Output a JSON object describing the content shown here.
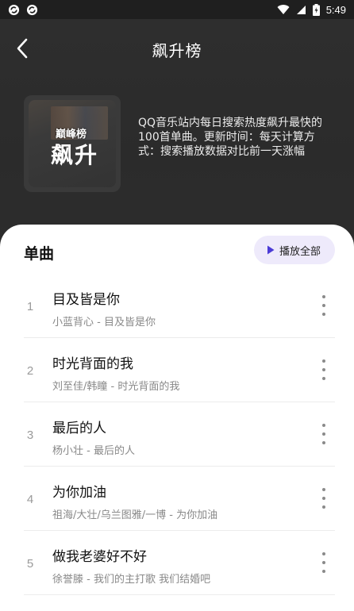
{
  "status_bar": {
    "time": "5:49",
    "left_icons": [
      "sync-icon",
      "sync-icon"
    ],
    "right_icons": [
      "wifi-icon",
      "signal-icon",
      "battery-icon"
    ]
  },
  "header": {
    "title": "飙升榜",
    "back_icon": "chevron-left-icon"
  },
  "cover": {
    "brand": "巅峰榜",
    "title": "飙升"
  },
  "description": "QQ音乐站内每日搜索热度飙升最快的100首单曲。更新时间：每天计算方式：搜索播放数据对比前一天涨幅",
  "section": {
    "title": "单曲",
    "play_all_label": "播放全部",
    "play_icon": "play-icon"
  },
  "songs": [
    {
      "index": "1",
      "title": "目及皆是你",
      "subtitle": "小蓝背心 - 目及皆是你"
    },
    {
      "index": "2",
      "title": "时光背面的我",
      "subtitle": "刘至佳/韩瞳 - 时光背面的我"
    },
    {
      "index": "3",
      "title": "最后的人",
      "subtitle": "杨小壮 - 最后的人"
    },
    {
      "index": "4",
      "title": "为你加油",
      "subtitle": "祖海/大壮/乌兰图雅/一博 - 为你加油"
    },
    {
      "index": "5",
      "title": "做我老婆好不好",
      "subtitle": "徐誉滕 - 我们的主打歌 我们结婚吧"
    }
  ],
  "colors": {
    "header_bg": "#2b2b2b",
    "accent_play": "#4b3bd6",
    "play_all_bg": "#eeeafb"
  }
}
